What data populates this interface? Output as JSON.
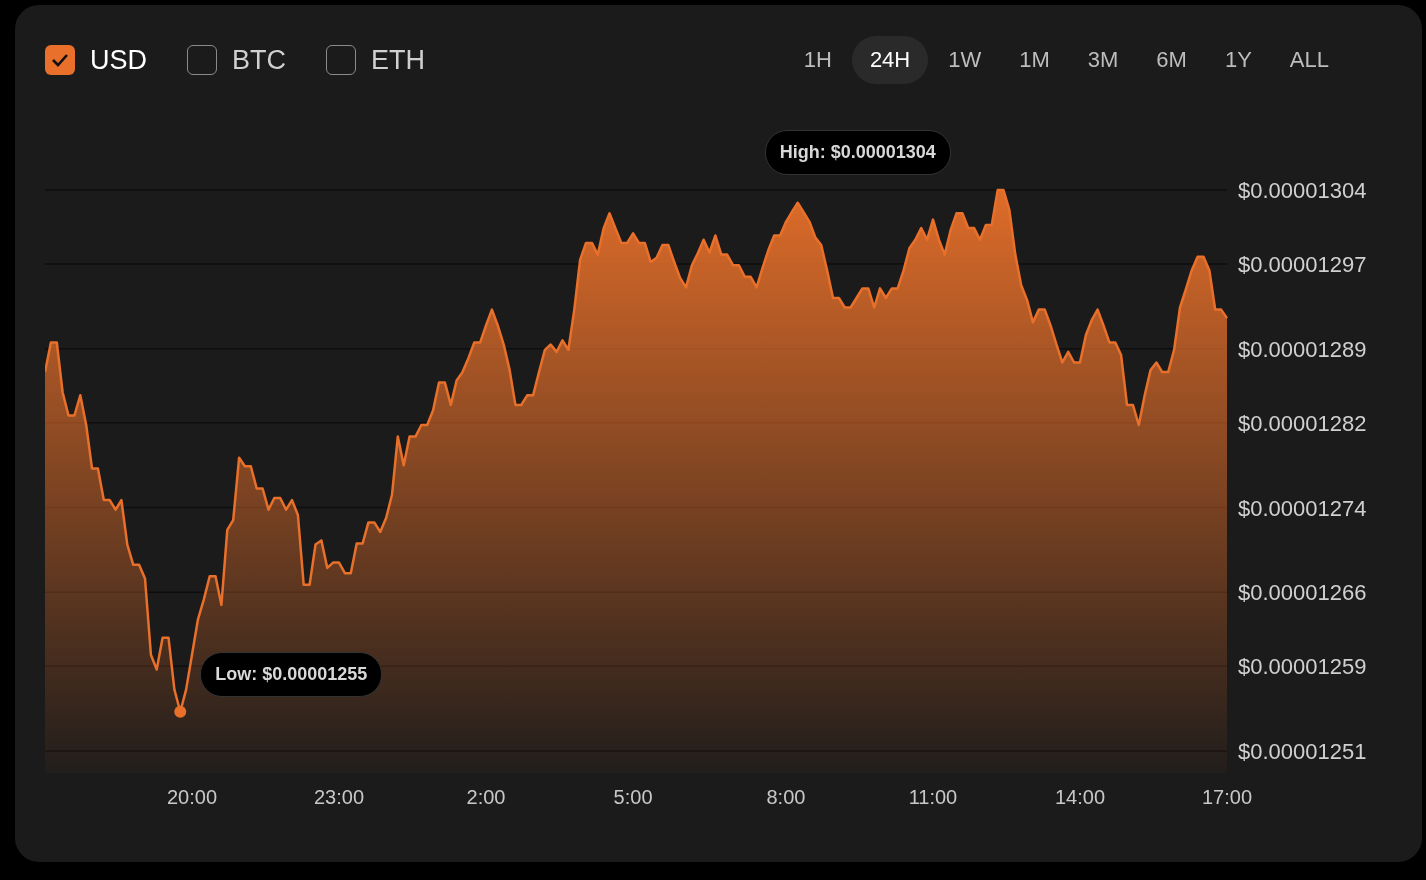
{
  "currencies": [
    {
      "label": "USD",
      "checked": true
    },
    {
      "label": "BTC",
      "checked": false
    },
    {
      "label": "ETH",
      "checked": false
    }
  ],
  "ranges": [
    {
      "label": "1H",
      "selected": false
    },
    {
      "label": "24H",
      "selected": true
    },
    {
      "label": "1W",
      "selected": false
    },
    {
      "label": "1M",
      "selected": false
    },
    {
      "label": "3M",
      "selected": false
    },
    {
      "label": "6M",
      "selected": false
    },
    {
      "label": "1Y",
      "selected": false
    },
    {
      "label": "ALL",
      "selected": false
    }
  ],
  "chart_data": {
    "type": "area",
    "categories": [
      null,
      null,
      null,
      null,
      null,
      null,
      null,
      null,
      null,
      null,
      null,
      null,
      null,
      null,
      null,
      null,
      null,
      null,
      null,
      null,
      null,
      null,
      null,
      null,
      null,
      "20:00",
      null,
      null,
      null,
      null,
      null,
      null,
      null,
      null,
      null,
      null,
      null,
      null,
      null,
      null,
      null,
      null,
      null,
      null,
      null,
      null,
      null,
      null,
      null,
      null,
      "23:00",
      null,
      null,
      null,
      null,
      null,
      null,
      null,
      null,
      null,
      null,
      null,
      null,
      null,
      null,
      null,
      null,
      null,
      null,
      null,
      null,
      null,
      null,
      null,
      null,
      "2:00",
      null,
      null,
      null,
      null,
      null,
      null,
      null,
      null,
      null,
      null,
      null,
      null,
      null,
      null,
      null,
      null,
      null,
      null,
      null,
      null,
      null,
      null,
      null,
      null,
      "5:00",
      null,
      null,
      null,
      null,
      null,
      null,
      null,
      null,
      null,
      null,
      null,
      null,
      null,
      null,
      null,
      null,
      null,
      null,
      null,
      null,
      null,
      null,
      null,
      null,
      null,
      "8:00",
      null,
      null,
      null,
      null,
      null,
      null,
      null,
      null,
      null,
      null,
      null,
      null,
      null,
      null,
      null,
      null,
      null,
      null,
      null,
      null,
      null,
      null,
      null,
      null,
      "11:00",
      null,
      null,
      null,
      null,
      null,
      null,
      null,
      null,
      null,
      null,
      null,
      null,
      null,
      null,
      null,
      null,
      null,
      null,
      null,
      null,
      null,
      null,
      null,
      null,
      "14:00",
      null,
      null,
      null,
      null,
      null,
      null,
      null,
      null,
      null,
      null,
      null,
      null,
      null,
      null,
      null,
      null,
      null,
      null,
      null,
      null,
      null,
      null,
      null,
      null,
      "17:00"
    ],
    "series": [
      {
        "color": "#e8702a",
        "values": [
          1.2868e-05,
          1.2896e-05,
          1.2896e-05,
          1.2849e-05,
          1.2827e-05,
          1.2827e-05,
          1.2846e-05,
          1.2818e-05,
          1.2777e-05,
          1.2777e-05,
          1.2747e-05,
          1.2747e-05,
          1.2738e-05,
          1.2747e-05,
          1.2705e-05,
          1.2686e-05,
          1.2686e-05,
          1.2673e-05,
          1.2601e-05,
          1.2587e-05,
          1.2617e-05,
          1.2617e-05,
          1.2568e-05,
          1.2547e-05,
          1.2568e-05,
          1.2601e-05,
          1.2634e-05,
          1.2653e-05,
          1.2675e-05,
          1.2675e-05,
          1.2648e-05,
          1.2719e-05,
          1.2728e-05,
          1.2787e-05,
          1.2779e-05,
          1.2779e-05,
          1.2758e-05,
          1.2758e-05,
          1.2738e-05,
          1.2749e-05,
          1.2749e-05,
          1.2738e-05,
          1.2747e-05,
          1.2733e-05,
          1.2667e-05,
          1.2667e-05,
          1.2705e-05,
          1.2709e-05,
          1.2683e-05,
          1.2688e-05,
          1.2688e-05,
          1.2678e-05,
          1.2678e-05,
          1.2706e-05,
          1.2706e-05,
          1.2726e-05,
          1.2726e-05,
          1.2717e-05,
          1.273e-05,
          1.2752e-05,
          1.2807e-05,
          1.278e-05,
          1.2807e-05,
          1.2807e-05,
          1.2818e-05,
          1.2818e-05,
          1.2832e-05,
          1.2858e-05,
          1.2858e-05,
          1.2837e-05,
          1.286e-05,
          1.2868e-05,
          1.2881e-05,
          1.2896e-05,
          1.2896e-05,
          1.2912e-05,
          1.2927e-05,
          1.2912e-05,
          1.2894e-05,
          1.287e-05,
          1.2837e-05,
          1.2837e-05,
          1.2846e-05,
          1.2846e-05,
          1.2868e-05,
          1.2889e-05,
          1.2894e-05,
          1.2887e-05,
          1.2898e-05,
          1.2889e-05,
          1.2927e-05,
          1.2974e-05,
          1.299e-05,
          1.299e-05,
          1.2979e-05,
          1.3004e-05,
          1.3018e-05,
          1.3004e-05,
          1.299e-05,
          1.299e-05,
          1.2999e-05,
          1.299e-05,
          1.299e-05,
          1.2972e-05,
          1.2976e-05,
          1.2988e-05,
          1.2988e-05,
          1.2972e-05,
          1.2957e-05,
          1.2948e-05,
          1.2969e-05,
          1.298e-05,
          1.2993e-05,
          1.2981e-05,
          1.2997e-05,
          1.2979e-05,
          1.2979e-05,
          1.2969e-05,
          1.2969e-05,
          1.2958e-05,
          1.2958e-05,
          1.2948e-05,
          1.2966e-05,
          1.2983e-05,
          1.2997e-05,
          1.2997e-05,
          1.301e-05,
          1.3019e-05,
          1.3028e-05,
          1.3019e-05,
          1.301e-05,
          1.2995e-05,
          1.2988e-05,
          1.2964e-05,
          1.2938e-05,
          1.2938e-05,
          1.2929e-05,
          1.2929e-05,
          1.2938e-05,
          1.2947e-05,
          1.2947e-05,
          1.2929e-05,
          1.2947e-05,
          1.2938e-05,
          1.2947e-05,
          1.2947e-05,
          1.2964e-05,
          1.2985e-05,
          1.2993e-05,
          1.3004e-05,
          1.2993e-05,
          1.3012e-05,
          1.2993e-05,
          1.2979e-05,
          1.3002e-05,
          1.3018e-05,
          1.3018e-05,
          1.3004e-05,
          1.3004e-05,
          1.2993e-05,
          1.3007e-05,
          1.3007e-05,
          1.304e-05,
          1.304e-05,
          1.3021e-05,
          1.2979e-05,
          1.295e-05,
          1.2936e-05,
          1.2915e-05,
          1.2927e-05,
          1.2927e-05,
          1.2912e-05,
          1.2894e-05,
          1.2877e-05,
          1.2887e-05,
          1.2877e-05,
          1.2877e-05,
          1.2903e-05,
          1.2917e-05,
          1.2927e-05,
          1.2912e-05,
          1.2896e-05,
          1.2896e-05,
          1.2884e-05,
          1.2837e-05,
          1.2837e-05,
          1.2818e-05,
          1.2846e-05,
          1.287e-05,
          1.2877e-05,
          1.2868e-05,
          1.2868e-05,
          1.2889e-05,
          1.2929e-05,
          1.2946e-05,
          1.2964e-05,
          1.2977e-05,
          1.2977e-05,
          1.2964e-05,
          1.2927e-05,
          1.2927e-05,
          1.2919e-05
        ]
      }
    ],
    "ylim": [
      1.251e-05,
      1.304e-05
    ],
    "grid": true,
    "yticks": [
      {
        "value": 1.304e-05,
        "label": "$0.00001304"
      },
      {
        "value": 1.297e-05,
        "label": "$0.00001297"
      },
      {
        "value": 1.289e-05,
        "label": "$0.00001289"
      },
      {
        "value": 1.282e-05,
        "label": "$0.00001282"
      },
      {
        "value": 1.274e-05,
        "label": "$0.00001274"
      },
      {
        "value": 1.266e-05,
        "label": "$0.00001266"
      },
      {
        "value": 1.259e-05,
        "label": "$0.00001259"
      },
      {
        "value": 1.251e-05,
        "label": "$0.00001251"
      }
    ]
  },
  "high_tooltip": "High: $0.00001304",
  "low_tooltip": "Low: $0.00001255"
}
